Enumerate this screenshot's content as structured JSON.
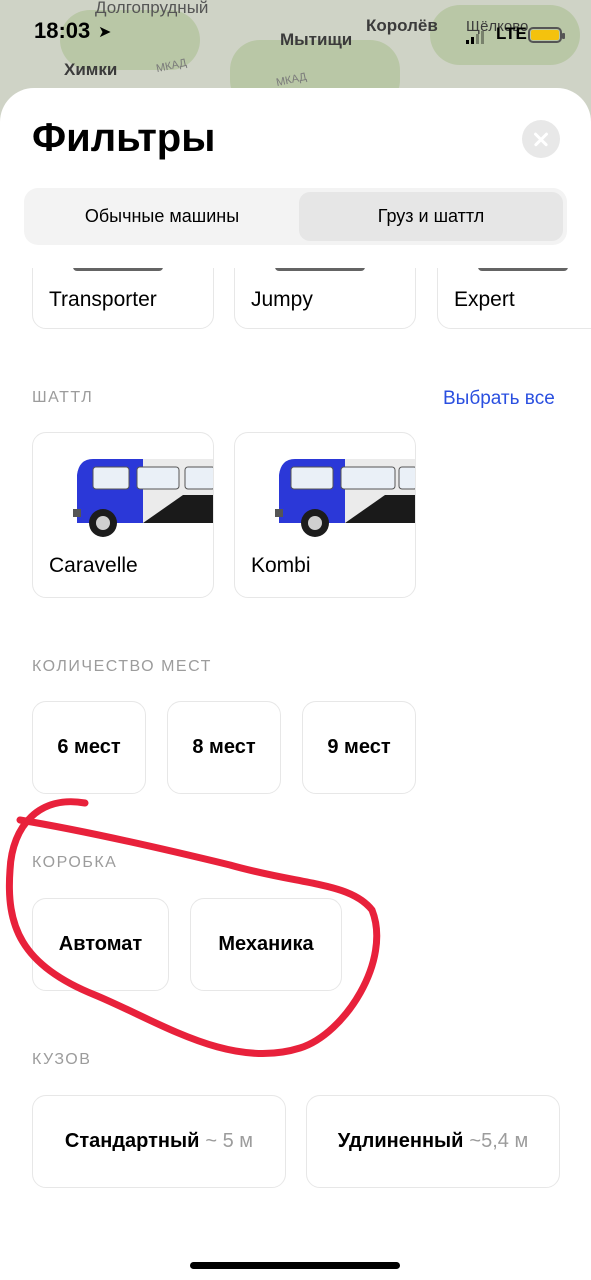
{
  "status": {
    "time": "18:03",
    "network": "LTE"
  },
  "map": {
    "labels": [
      "Долгопрудный",
      "Химки",
      "Мытищи",
      "Королёв",
      "Щёлково"
    ],
    "road_labels": [
      "МКАД",
      "МКАД"
    ]
  },
  "sheet": {
    "title": "Фильтры",
    "tabs": [
      {
        "label": "Обычные машины"
      },
      {
        "label": "Груз и шаттл"
      }
    ]
  },
  "cargo_models": [
    {
      "label": "Transporter"
    },
    {
      "label": "Jumpy"
    },
    {
      "label": "Expert"
    }
  ],
  "shuttle": {
    "heading": "ШАТТЛ",
    "select_all": "Выбрать все",
    "models": [
      {
        "label": "Caravelle"
      },
      {
        "label": "Kombi"
      }
    ]
  },
  "seats": {
    "heading": "КОЛИЧЕСТВО МЕСТ",
    "options": [
      {
        "label": "6 мест"
      },
      {
        "label": "8 мест"
      },
      {
        "label": "9 мест"
      }
    ]
  },
  "gearbox": {
    "heading": "КОРОБКА",
    "options": [
      {
        "label": "Автомат"
      },
      {
        "label": "Механика"
      }
    ]
  },
  "body": {
    "heading": "КУЗОВ",
    "options": [
      {
        "label": "Стандартный",
        "hint": "~ 5 м"
      },
      {
        "label": "Удлиненный",
        "hint": "~5,4 м"
      }
    ]
  },
  "colors": {
    "accent": "#2a4fe0",
    "van_blue": "#2b38d8",
    "annotation": "#e8213b",
    "battery": "#f4c20d"
  }
}
